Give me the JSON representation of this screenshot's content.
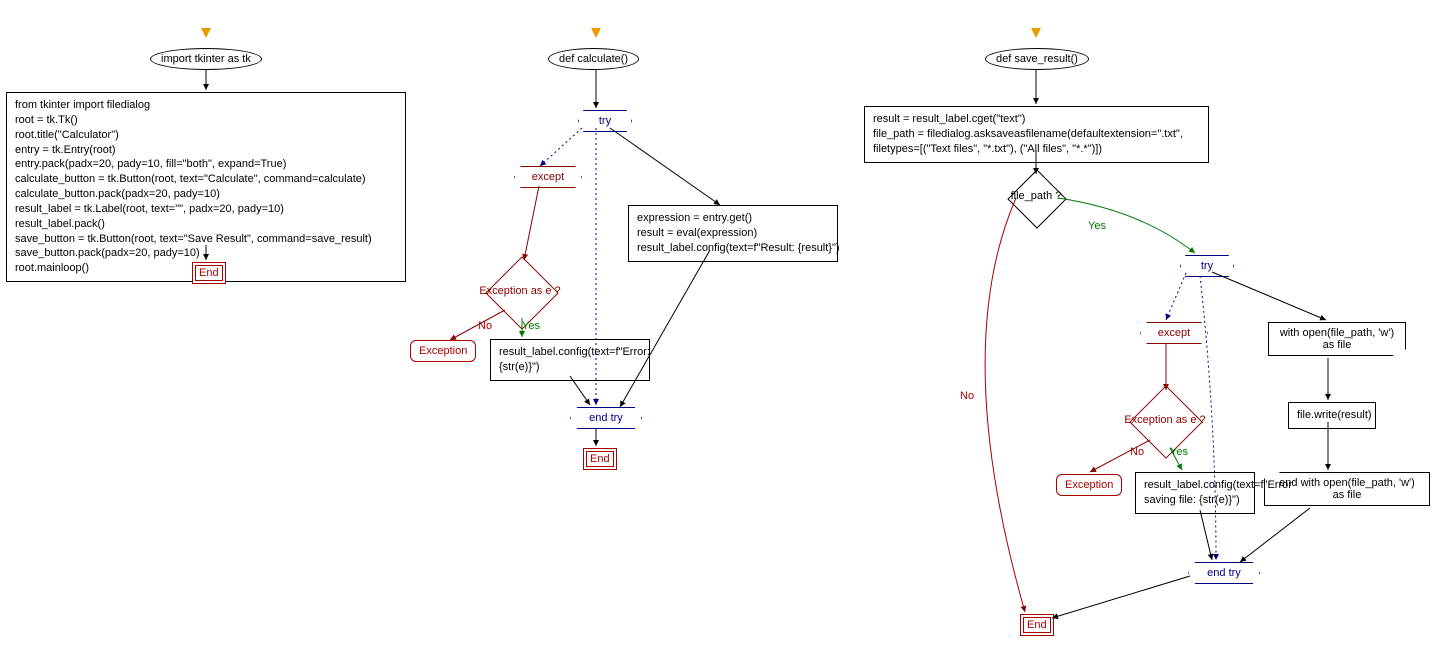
{
  "chart1": {
    "start": "import tkinter as tk",
    "code": "from tkinter import filedialog\nroot = tk.Tk()\nroot.title(\"Calculator\")\nentry = tk.Entry(root)\nentry.pack(padx=20, pady=10, fill=\"both\", expand=True)\ncalculate_button = tk.Button(root, text=\"Calculate\", command=calculate)\ncalculate_button.pack(padx=20, pady=10)\nresult_label = tk.Label(root, text=\"\", padx=20, pady=10)\nresult_label.pack()\nsave_button = tk.Button(root, text=\"Save Result\", command=save_result)\nsave_button.pack(padx=20, pady=10)\nroot.mainloop()",
    "end": "End"
  },
  "chart2": {
    "start": "def calculate()",
    "try": "try",
    "try_body": "expression = entry.get()\nresult = eval(expression)\nresult_label.config(text=f\"Result: {result}\")",
    "except": "except",
    "except_cond": "Exception as e ?",
    "except_body": "result_label.config(text=f\"Error:\n{str(e)}\")",
    "exception": "Exception",
    "endtry": "end try",
    "end": "End",
    "yes": "Yes",
    "no": "No"
  },
  "chart3": {
    "start": "def save_result()",
    "code1": "result = result_label.cget(\"text\")\nfile_path = filedialog.asksaveasfilename(defaultextension=\".txt\",\nfiletypes=[(\"Text files\", \"*.txt\"), (\"All files\", \"*.*\")])",
    "cond": "file_path ?",
    "try": "try",
    "with_open": "with open(file_path,\n'w') as file",
    "write": "file.write(result)",
    "end_with": "end with open(file_path,\n'w') as file",
    "except": "except",
    "except_cond": "Exception as e ?",
    "except_body": "result_label.config(text=f\"Error\nsaving file: {str(e)}\")",
    "exception": "Exception",
    "endtry": "end try",
    "end": "End",
    "yes": "Yes",
    "no": "No"
  }
}
